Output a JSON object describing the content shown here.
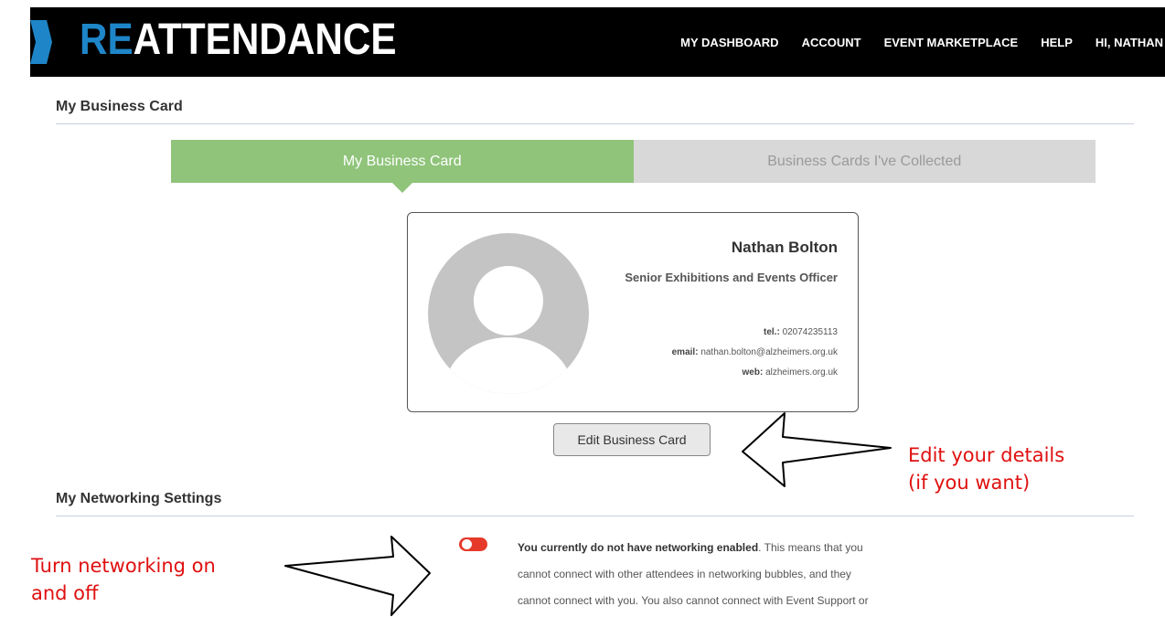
{
  "header": {
    "logo_re": "RE",
    "logo_rest": "ATTENDANCE",
    "nav": [
      "MY DASHBOARD",
      "ACCOUNT",
      "EVENT MARKETPLACE",
      "HELP",
      "HI, NATHAN"
    ],
    "colors": {
      "bar": "#000000",
      "accent": "#1e86c8"
    }
  },
  "page_title": "My Business Card",
  "tabs": [
    {
      "label": "My Business Card",
      "active": true
    },
    {
      "label": "Business Cards I've Collected",
      "active": false
    }
  ],
  "card": {
    "name": "Nathan Bolton",
    "job_title": "Senior Exhibitions and Events Officer",
    "tel_label": "tel.:",
    "tel": "02074235113",
    "email_label": "email:",
    "email": "nathan.bolton@alzheimers.org.uk",
    "web_label": "web:",
    "web": "alzheimers.org.uk",
    "avatar_icon": "user-placeholder-icon"
  },
  "edit_button": "Edit Business Card",
  "annotations": {
    "edit_line1": "Edit your details",
    "edit_line2": "(if you want)",
    "toggle_line1": "Turn networking on",
    "toggle_line2": "and off",
    "color": "#e01010"
  },
  "networking": {
    "title": "My Networking Settings",
    "enabled": false,
    "status_bold": "You currently do not have networking enabled",
    "line1_rest": ". This means that you",
    "line2": "cannot connect with other attendees in networking bubbles, and they",
    "line3": "cannot connect with you. You also cannot connect with Event Support or",
    "toggle_color": "#e53a2a"
  }
}
